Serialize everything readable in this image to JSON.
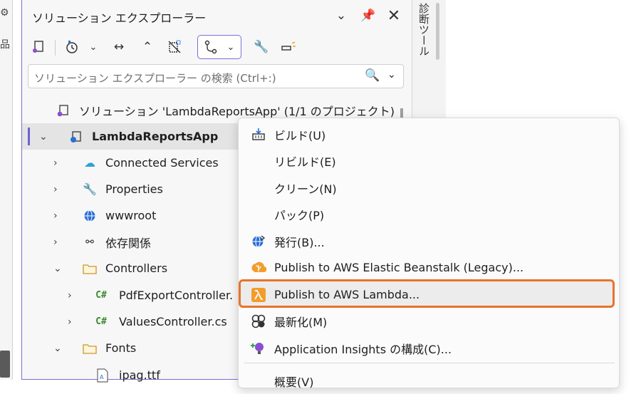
{
  "left_strip": {
    "gear": "⚙",
    "tab": "品"
  },
  "right_strip": {
    "label": "診断ツール"
  },
  "explorer": {
    "title": "ソリューション エクスプローラー",
    "search_placeholder": "ソリューション エクスプローラー の検索 (Ctrl+:)",
    "tree": [
      {
        "label": "ソリューション 'LambdaReportsApp' (1/1 のプロジェクト)",
        "icon": "solution-icon"
      },
      {
        "label": "LambdaReportsApp",
        "icon": "web-project-icon"
      },
      {
        "label": "Connected Services",
        "icon": "connected-services-icon"
      },
      {
        "label": "Properties",
        "icon": "wrench-icon"
      },
      {
        "label": "wwwroot",
        "icon": "globe-icon"
      },
      {
        "label": "依存関係",
        "icon": "dependencies-icon"
      },
      {
        "label": "Controllers",
        "icon": "folder-icon"
      },
      {
        "label": "PdfExportController.",
        "icon": "csharp-icon",
        "badge": "C#"
      },
      {
        "label": "ValuesController.cs",
        "icon": "csharp-icon",
        "badge": "C#"
      },
      {
        "label": "Fonts",
        "icon": "folder-icon"
      },
      {
        "label": "ipag.ttf",
        "icon": "font-file-icon"
      }
    ]
  },
  "context_menu": {
    "items": [
      {
        "label": "ビルド(U)",
        "icon": "build-icon"
      },
      {
        "label": "リビルド(E)",
        "icon": ""
      },
      {
        "label": "クリーン(N)",
        "icon": ""
      },
      {
        "label": "パック(P)",
        "icon": ""
      },
      {
        "label": "発行(B)...",
        "icon": "publish-globe-icon"
      },
      {
        "label": "Publish to AWS Elastic Beanstalk (Legacy)...",
        "icon": "aws-beanstalk-icon"
      },
      {
        "label": "Publish to AWS Lambda...",
        "icon": "aws-lambda-icon"
      },
      {
        "label": "最新化(M)",
        "icon": "modernize-icon"
      },
      {
        "label": "Application Insights の構成(C)...",
        "icon": "app-insights-icon"
      },
      {
        "label": "概要(V)",
        "icon": ""
      }
    ],
    "highlight_color": "#e8732a"
  }
}
